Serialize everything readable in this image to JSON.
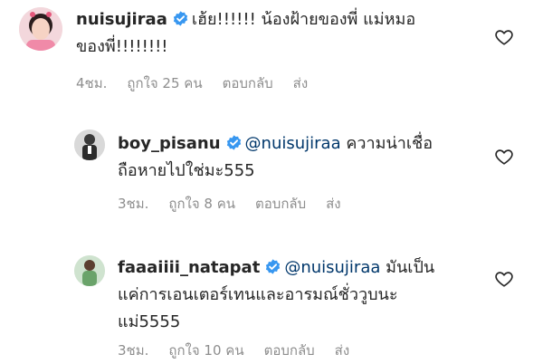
{
  "comments": [
    {
      "username": "nuisujiraa",
      "verified": true,
      "mention": "",
      "text_line1": "เฮ้ย!!!!!! น้องฝ้ายของพี่ แม่หมอ",
      "text_line2": "ของพี่!!!!!!!!",
      "text_line3": "",
      "time": "4ชม.",
      "likes": "ถูกใจ 25 คน",
      "reply": "ตอบกลับ",
      "send": "ส่ง"
    },
    {
      "username": "boy_pisanu",
      "verified": true,
      "mention": "@nuisujiraa",
      "text_line1": "ความน่าเชื่อ",
      "text_line2": "ถือหายไปใช่มะ555",
      "text_line3": "",
      "time": "3ชม.",
      "likes": "ถูกใจ 8 คน",
      "reply": "ตอบกลับ",
      "send": "ส่ง"
    },
    {
      "username": "faaaiiii_natapat",
      "verified": true,
      "mention": "@nuisujiraa",
      "text_line1": "มันเป็น",
      "text_line2": "แค่การเอนเตอร์เทนและอารมณ์ชั่ววูบนะ",
      "text_line3": "แม่5555",
      "time": "3ชม.",
      "likes": "ถูกใจ 10 คน",
      "reply": "ตอบกลับ",
      "send": "ส่ง"
    }
  ],
  "colors": {
    "verified_blue": "#3897f0",
    "mention_blue": "#00376b",
    "meta_gray": "#8e8e8e"
  },
  "icons": [
    "verified-badge-icon",
    "heart-outline-icon"
  ]
}
